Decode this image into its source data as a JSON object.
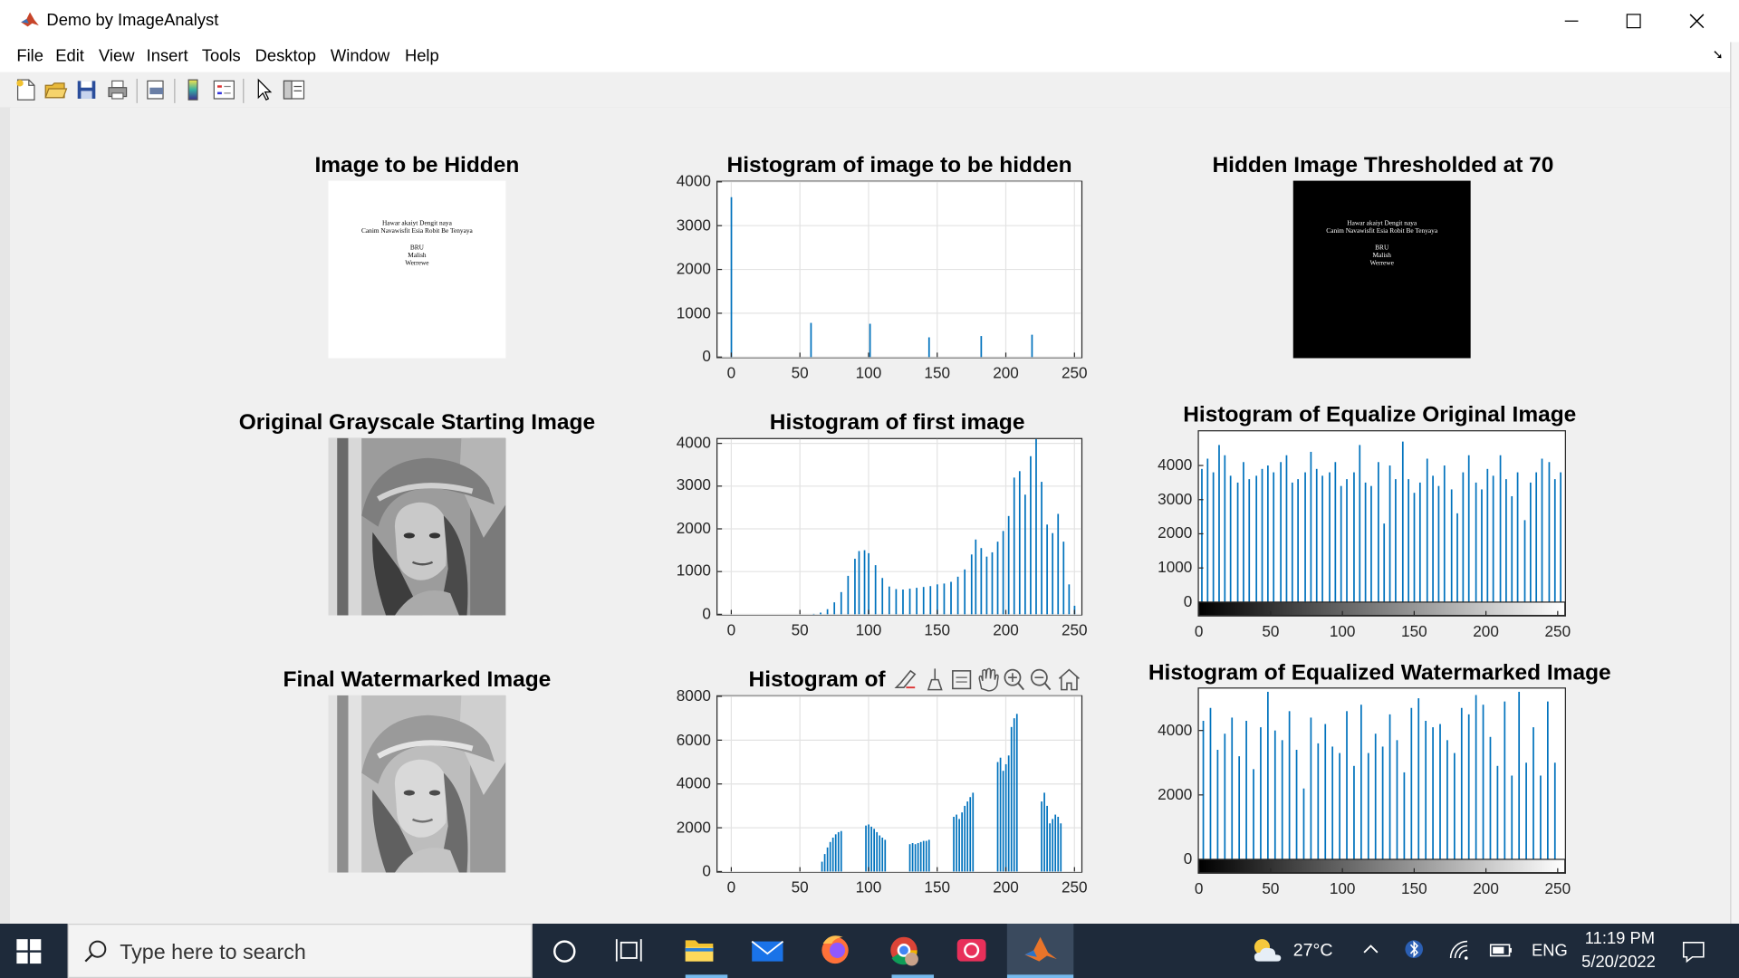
{
  "window": {
    "title": "Demo by ImageAnalyst"
  },
  "menu": [
    "File",
    "Edit",
    "View",
    "Insert",
    "Tools",
    "Desktop",
    "Window",
    "Help"
  ],
  "toolbar": [
    "new-figure-icon",
    "open-file-icon",
    "save-icon",
    "print-icon",
    "print-preview-icon",
    "colorbar-icon",
    "legend-icon",
    "edit-plot-icon",
    "property-inspector-icon"
  ],
  "panels": {
    "hidden_image_title": "Image to be Hidden",
    "hidden_text": [
      "Hawar akaiyt Dengit naya",
      "Canim Navawisfit Esia Robit Be Tenyaya",
      "BRU",
      "Malish",
      "Werrewe"
    ],
    "thresholded_title": "Hidden Image Thresholded at 70",
    "original_title": "Original Grayscale Starting Image",
    "final_title": "Final Watermarked Image"
  },
  "axes_toolbar_icons": [
    "brush-icon",
    "data-tips-icon",
    "data-cursor-icon",
    "pan-icon",
    "zoom-in-icon",
    "zoom-out-icon",
    "home-icon"
  ],
  "chart_data": [
    {
      "type": "bar",
      "title": "Histogram of image to be hidden",
      "xlim": [
        -10,
        255
      ],
      "ylim": [
        0,
        4000
      ],
      "xticks": [
        0,
        50,
        100,
        150,
        200,
        250
      ],
      "yticks": [
        0,
        1000,
        2000,
        3000,
        4000
      ],
      "grid": true,
      "color": "#0072bd",
      "x": [
        0,
        58,
        101,
        144,
        182,
        219
      ],
      "values": [
        3650,
        780,
        760,
        450,
        480,
        510
      ]
    },
    {
      "type": "bar",
      "title": "Histogram of first image",
      "xlim": [
        -10,
        255
      ],
      "ylim": [
        0,
        4100
      ],
      "xticks": [
        0,
        50,
        100,
        150,
        200,
        250
      ],
      "yticks": [
        0,
        1000,
        2000,
        3000,
        4000
      ],
      "grid": true,
      "color": "#0072bd",
      "x": [
        60,
        65,
        70,
        75,
        80,
        85,
        90,
        93,
        97,
        100,
        105,
        110,
        115,
        120,
        125,
        130,
        135,
        140,
        145,
        150,
        155,
        160,
        165,
        170,
        175,
        178,
        182,
        186,
        190,
        194,
        198,
        202,
        206,
        210,
        214,
        218,
        222,
        226,
        230,
        234,
        238,
        242,
        246,
        250
      ],
      "values": [
        10,
        40,
        120,
        280,
        520,
        900,
        1300,
        1480,
        1500,
        1430,
        1150,
        850,
        650,
        590,
        580,
        600,
        620,
        640,
        660,
        700,
        720,
        760,
        880,
        1050,
        1400,
        1750,
        1550,
        1350,
        1450,
        1700,
        1950,
        2300,
        3200,
        3350,
        2800,
        3700,
        4100,
        3100,
        2100,
        1900,
        2350,
        1700,
        700,
        200
      ]
    },
    {
      "type": "bar",
      "title": "Histogram of i",
      "xlim": [
        -10,
        255
      ],
      "ylim": [
        0,
        8000
      ],
      "xticks": [
        0,
        50,
        100,
        150,
        200,
        250
      ],
      "yticks": [
        0,
        2000,
        4000,
        6000,
        8000
      ],
      "grid": true,
      "color": "#0072bd",
      "x": [
        66,
        68,
        70,
        72,
        74,
        76,
        78,
        80,
        98,
        100,
        102,
        104,
        106,
        108,
        110,
        112,
        130,
        132,
        134,
        136,
        138,
        140,
        142,
        144,
        162,
        164,
        166,
        168,
        170,
        172,
        174,
        176,
        194,
        196,
        198,
        200,
        202,
        204,
        206,
        208,
        226,
        228,
        230,
        232,
        234,
        236,
        238,
        240
      ],
      "values": [
        450,
        800,
        1100,
        1350,
        1550,
        1700,
        1800,
        1850,
        2100,
        2150,
        2050,
        1950,
        1800,
        1650,
        1550,
        1450,
        1250,
        1300,
        1250,
        1300,
        1350,
        1400,
        1400,
        1450,
        2500,
        2600,
        2400,
        2700,
        3000,
        3200,
        3400,
        3600,
        5000,
        5200,
        4600,
        4900,
        5300,
        6600,
        7000,
        7200,
        3200,
        3600,
        3000,
        2200,
        2400,
        2600,
        2500,
        2200
      ]
    },
    {
      "type": "bar",
      "title": "Histogram of Equalize Original Image",
      "xlim": [
        0,
        255
      ],
      "ylim": [
        0,
        5000
      ],
      "xticks": [
        0,
        50,
        100,
        150,
        200,
        250
      ],
      "yticks": [
        0,
        1000,
        2000,
        3000,
        4000
      ],
      "grid": false,
      "color": "#0072bd",
      "colorbar": "gray",
      "x": [
        2,
        6,
        10,
        14,
        18,
        22,
        27,
        31,
        35,
        40,
        44,
        48,
        52,
        57,
        61,
        65,
        69,
        74,
        78,
        82,
        86,
        91,
        95,
        99,
        103,
        108,
        112,
        116,
        120,
        125,
        129,
        133,
        137,
        142,
        146,
        150,
        154,
        159,
        163,
        167,
        171,
        176,
        180,
        184,
        188,
        193,
        197,
        201,
        205,
        210,
        214,
        218,
        222,
        227,
        231,
        235,
        239,
        244,
        248,
        252
      ],
      "values": [
        3900,
        4200,
        3800,
        4600,
        4300,
        3700,
        3500,
        4100,
        3600,
        3700,
        3900,
        4000,
        3800,
        4100,
        4300,
        3500,
        3600,
        3800,
        4400,
        3900,
        3700,
        3800,
        4100,
        3400,
        3600,
        3800,
        4600,
        3500,
        3400,
        4100,
        2300,
        4000,
        3600,
        4700,
        3600,
        3200,
        3500,
        4200,
        3700,
        3400,
        4000,
        3300,
        2600,
        3800,
        4300,
        3500,
        3300,
        3900,
        3700,
        4300,
        3600,
        3100,
        3800,
        2400,
        3500,
        3800,
        4200,
        4100,
        3600,
        3800
      ]
    },
    {
      "type": "bar",
      "title": "Histogram of Equalized Watermarked Image",
      "xlim": [
        0,
        255
      ],
      "ylim": [
        0,
        5300
      ],
      "xticks": [
        0,
        50,
        100,
        150,
        200,
        250
      ],
      "yticks": [
        0,
        2000,
        4000
      ],
      "grid": false,
      "color": "#0072bd",
      "colorbar": "gray",
      "x": [
        3,
        8,
        13,
        18,
        23,
        28,
        33,
        38,
        43,
        48,
        53,
        58,
        63,
        68,
        73,
        78,
        83,
        88,
        93,
        98,
        103,
        108,
        113,
        118,
        123,
        128,
        133,
        138,
        143,
        148,
        153,
        158,
        163,
        168,
        173,
        178,
        183,
        188,
        193,
        198,
        203,
        208,
        213,
        218,
        223,
        228,
        233,
        238,
        243,
        248
      ],
      "values": [
        4300,
        4700,
        3400,
        3900,
        4400,
        3200,
        4300,
        2800,
        4100,
        5200,
        4000,
        3700,
        4600,
        3400,
        2200,
        4400,
        3600,
        4200,
        3500,
        3300,
        4600,
        2900,
        4800,
        3300,
        3900,
        3500,
        4500,
        3700,
        2700,
        4700,
        5000,
        4300,
        4100,
        4200,
        3700,
        3300,
        4700,
        4500,
        5100,
        4800,
        3800,
        2900,
        4900,
        2600,
        5200,
        3000,
        4100,
        2600,
        4900,
        3000
      ]
    }
  ],
  "taskbar": {
    "search_placeholder": "Type here to search",
    "weather": "27°C",
    "language": "ENG",
    "time": "11:19 PM",
    "date": "5/20/2022",
    "apps": [
      "cortana-icon",
      "task-view-icon",
      "file-explorer-icon",
      "mail-icon",
      "firefox-icon",
      "chrome-icon",
      "snipping-tool-icon",
      "matlab-icon"
    ]
  }
}
